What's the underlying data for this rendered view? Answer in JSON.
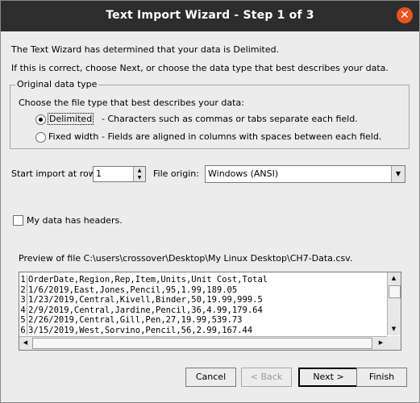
{
  "window": {
    "title": "Text Import Wizard - Step 1 of 3",
    "close_glyph": "✕"
  },
  "intro": {
    "line1": "The Text Wizard has determined that your data is Delimited.",
    "line2": "If this is correct, choose Next, or choose the data type that best describes your data."
  },
  "original_data_type": {
    "legend": "Original data type",
    "prompt": "Choose the file type that best describes your data:",
    "options": [
      {
        "label": "Delimited",
        "description": "- Characters such as commas or tabs separate each field.",
        "selected": true
      },
      {
        "label": "Fixed width",
        "description": "- Fields are aligned in columns with spaces between each field.",
        "selected": false
      }
    ]
  },
  "start_row": {
    "label": "Start import at row:",
    "value": "1"
  },
  "file_origin": {
    "label": "File origin:",
    "value": "Windows (ANSI)"
  },
  "headers_checkbox": {
    "label": "My data has headers.",
    "checked": false
  },
  "preview": {
    "label": "Preview of file C:\\users\\crossover\\Desktop\\My Linux Desktop\\CH7-Data.csv.",
    "rows": [
      {
        "n": "1",
        "text": "OrderDate,Region,Rep,Item,Units,Unit Cost,Total"
      },
      {
        "n": "2",
        "text": "1/6/2019,East,Jones,Pencil,95,1.99,189.05"
      },
      {
        "n": "3",
        "text": "1/23/2019,Central,Kivell,Binder,50,19.99,999.5"
      },
      {
        "n": "4",
        "text": "2/9/2019,Central,Jardine,Pencil,36,4.99,179.64"
      },
      {
        "n": "5",
        "text": "2/26/2019,Central,Gill,Pen,27,19.99,539.73"
      },
      {
        "n": "6",
        "text": "3/15/2019,West,Sorvino,Pencil,56,2.99,167.44"
      }
    ]
  },
  "buttons": {
    "cancel": "Cancel",
    "back": "< Back",
    "next": "Next >",
    "finish": "Finish"
  },
  "colors": {
    "titlebar": "#2d2d2d",
    "close": "#e95420",
    "dialog_bg": "#ececec"
  }
}
